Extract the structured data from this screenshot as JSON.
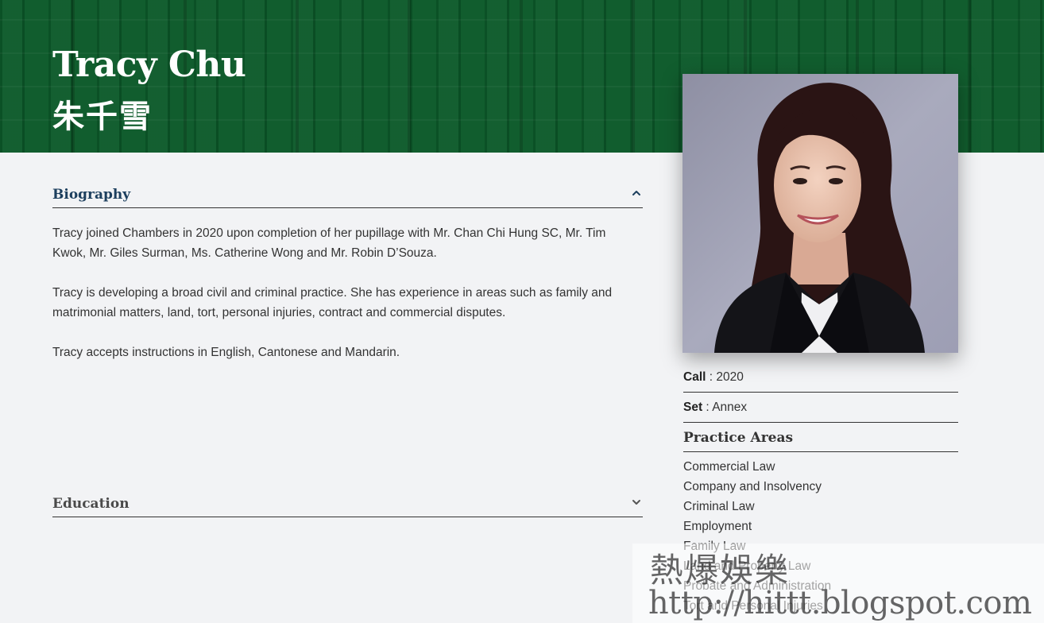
{
  "header": {
    "name_en": "Tracy Chu",
    "name_zh": "朱千雪"
  },
  "biography": {
    "title": "Biography",
    "expanded": true,
    "paragraphs": [
      "Tracy joined Chambers in 2020 upon completion of her pupillage with Mr. Chan Chi Hung SC, Mr. Tim Kwok, Mr. Giles Surman, Ms. Catherine Wong and Mr. Robin D’Souza.",
      "Tracy is developing a broad civil and criminal practice. She has experience in areas such as family and matrimonial matters, land, tort, personal injuries, contract and commercial disputes.",
      "Tracy accepts instructions in English, Cantonese and Mandarin."
    ]
  },
  "education": {
    "title": "Education",
    "expanded": false
  },
  "profile": {
    "call_label": "Call",
    "call_value": " : 2020",
    "set_label": "Set",
    "set_value": " : Annex"
  },
  "practice_areas": {
    "title": "Practice Areas",
    "items": [
      "Commercial Law",
      "Company and Insolvency",
      "Criminal Law",
      "Employment",
      "Family Law",
      "Land and Property Law",
      "Probate and Administration",
      "Tort and Personal Injuries"
    ]
  },
  "watermark": {
    "line1": "熱爆娛樂",
    "line2": "http://hittt.blogspot.com"
  },
  "icons": {
    "biography_toggle": "chevron-up-icon",
    "education_toggle": "chevron-down-icon"
  },
  "colors": {
    "hero_green": "#0c5a2a",
    "page_bg": "#f2f3f5",
    "heading_blue": "#1d3f5e"
  }
}
